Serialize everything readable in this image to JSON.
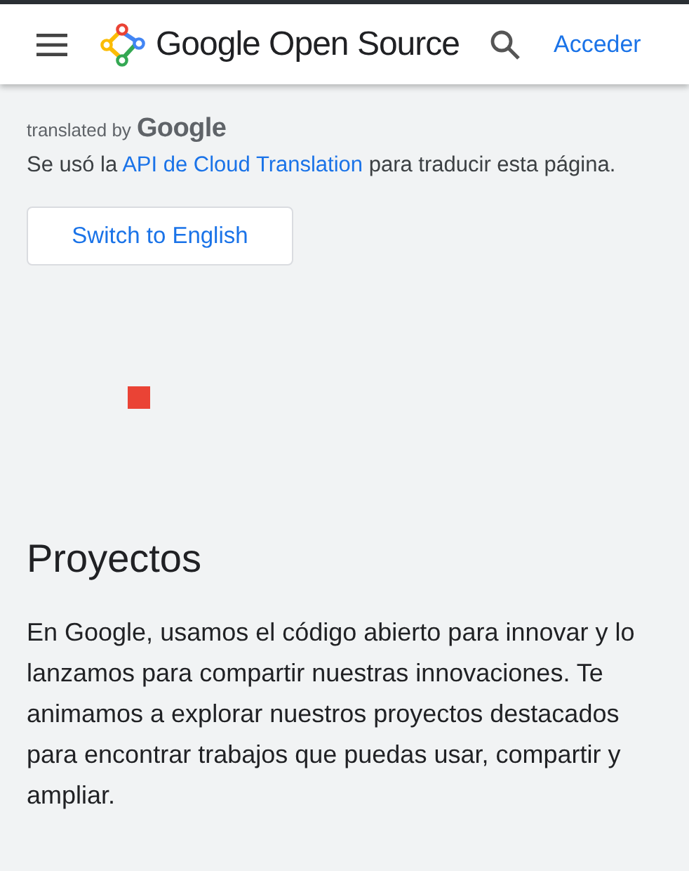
{
  "header": {
    "brand": "Google Open Source",
    "sign_in": "Acceder"
  },
  "translation": {
    "prefix": "translated by",
    "brand": "Google",
    "notice_before": "Se usó la",
    "notice_link": "API de Cloud Translation",
    "notice_after": "para traducir esta página.",
    "button": "Switch to English"
  },
  "section": {
    "title": "Proyectos",
    "body": "En Google, usamos el código abierto para innovar y lo lanzamos para compartir nuestras innovaciones. Te animamos a explorar nuestros proyectos destacados para encontrar trabajos que puedas usar, compartir y ampliar."
  }
}
